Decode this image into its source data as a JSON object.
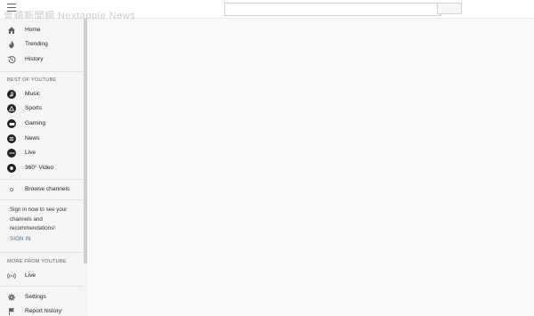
{
  "header": {
    "menu_icon": "hamburger-menu-icon",
    "watermark": "壹蘋新聞網 Nextapple News",
    "search": {
      "value": "",
      "placeholder": ""
    },
    "search_button_icon": "search-icon"
  },
  "sidebar": {
    "main_items": [
      {
        "label": "Home",
        "icon": "home-icon"
      },
      {
        "label": "Trending",
        "icon": "flame-icon"
      },
      {
        "label": "History",
        "icon": "history-icon"
      }
    ],
    "best_of_title": "BEST OF YOUTUBE",
    "best_of_items": [
      {
        "label": "Music",
        "icon": "music-icon"
      },
      {
        "label": "Sports",
        "icon": "sports-icon"
      },
      {
        "label": "Gaming",
        "icon": "gaming-icon"
      },
      {
        "label": "News",
        "icon": "news-icon"
      },
      {
        "label": "Live",
        "icon": "live-icon"
      },
      {
        "label": "360° Video",
        "icon": "360-video-icon"
      }
    ],
    "browse_channels": {
      "label": "Browse channels",
      "icon": "add-circle-icon"
    },
    "signin": {
      "text": "Sign in now to see your channels and recommendations!",
      "link": "SIGN IN"
    },
    "more_from_title": "MORE FROM YOUTUBE",
    "more_items": [
      {
        "label": "Live",
        "icon": "broadcast-icon"
      }
    ],
    "bottom_items": [
      {
        "label": "Settings",
        "icon": "gear-icon"
      },
      {
        "label": "Report history",
        "icon": "flag-icon"
      }
    ]
  },
  "colors": {
    "sidebar_bg": "#f5f5f5",
    "main_bg": "#f9f9f9",
    "link_blue": "#1e6bb8"
  }
}
